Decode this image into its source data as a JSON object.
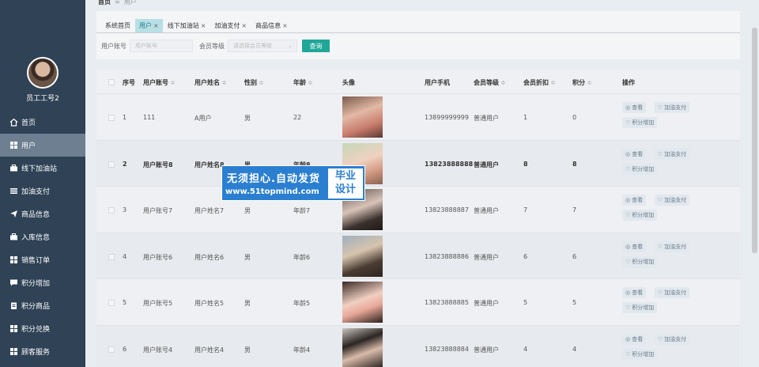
{
  "breadcrumb": {
    "home": "首页",
    "sep": "≡",
    "current": "用户"
  },
  "sidebar": {
    "user_name": "员工工号2",
    "items": [
      {
        "label": "首页",
        "icon": "home-icon"
      },
      {
        "label": "用户",
        "icon": "grid-icon",
        "active": true
      },
      {
        "label": "线下加油站",
        "icon": "briefcase-icon"
      },
      {
        "label": "加油支付",
        "icon": "list-icon"
      },
      {
        "label": "商品信息",
        "icon": "send-icon"
      },
      {
        "label": "入库信息",
        "icon": "briefcase-icon"
      },
      {
        "label": "销售订单",
        "icon": "grid-icon"
      },
      {
        "label": "积分增加",
        "icon": "chat-icon"
      },
      {
        "label": "积分商品",
        "icon": "clipboard-icon"
      },
      {
        "label": "积分兑换",
        "icon": "grid-icon"
      },
      {
        "label": "顾客服务",
        "icon": "grid-icon"
      }
    ]
  },
  "tabs": [
    {
      "label": "系统首页",
      "closable": false
    },
    {
      "label": "用户",
      "closable": true,
      "active": true
    },
    {
      "label": "线下加油站",
      "closable": true
    },
    {
      "label": "加油支付",
      "closable": true
    },
    {
      "label": "商品信息",
      "closable": true
    }
  ],
  "tab_close": "×",
  "search": {
    "account_label": "用户账号",
    "account_placeholder": "用户账号",
    "level_label": "会员等级",
    "level_placeholder": "请选择会员等级",
    "query_button": "查询"
  },
  "table": {
    "headers": [
      "序号",
      "用户账号",
      "用户姓名",
      "性别",
      "年龄",
      "头像",
      "用户手机",
      "会员等级",
      "会员折扣",
      "积分",
      "操作"
    ],
    "sort_glyph": "≑",
    "rows": [
      {
        "no": "1",
        "account": "111",
        "name": "A用户",
        "gender": "男",
        "age": "22",
        "phone": "13899999999",
        "level": "普通用户",
        "discount": "1",
        "points": "0"
      },
      {
        "no": "2",
        "account": "用户账号8",
        "name": "用户姓名8",
        "gender": "男",
        "age": "年龄8",
        "phone": "13823888888",
        "level": "普通用户",
        "discount": "8",
        "points": "8"
      },
      {
        "no": "3",
        "account": "用户账号7",
        "name": "用户姓名7",
        "gender": "男",
        "age": "年龄7",
        "phone": "13823888887",
        "level": "普通用户",
        "discount": "7",
        "points": "7"
      },
      {
        "no": "4",
        "account": "用户账号6",
        "name": "用户姓名6",
        "gender": "男",
        "age": "年龄6",
        "phone": "13823888886",
        "level": "普通用户",
        "discount": "6",
        "points": "6"
      },
      {
        "no": "5",
        "account": "用户账号5",
        "name": "用户姓名5",
        "gender": "男",
        "age": "年龄5",
        "phone": "13823888885",
        "level": "普通用户",
        "discount": "5",
        "points": "5"
      },
      {
        "no": "6",
        "account": "用户账号4",
        "name": "用户姓名4",
        "gender": "男",
        "age": "年龄4",
        "phone": "13823888884",
        "level": "普通用户",
        "discount": "4",
        "points": "4"
      }
    ],
    "actions": {
      "view": "查看",
      "pay": "加油支付",
      "points": "积分增加"
    }
  },
  "watermark": {
    "line1": "无须担心.自动发货",
    "line2": "www.51topmind.com",
    "box_line1": "毕业",
    "box_line2": "设计"
  },
  "colors": {
    "sidebar": "#2f4256",
    "accent": "#21a79a",
    "active_tab": "#b8dfe6"
  }
}
